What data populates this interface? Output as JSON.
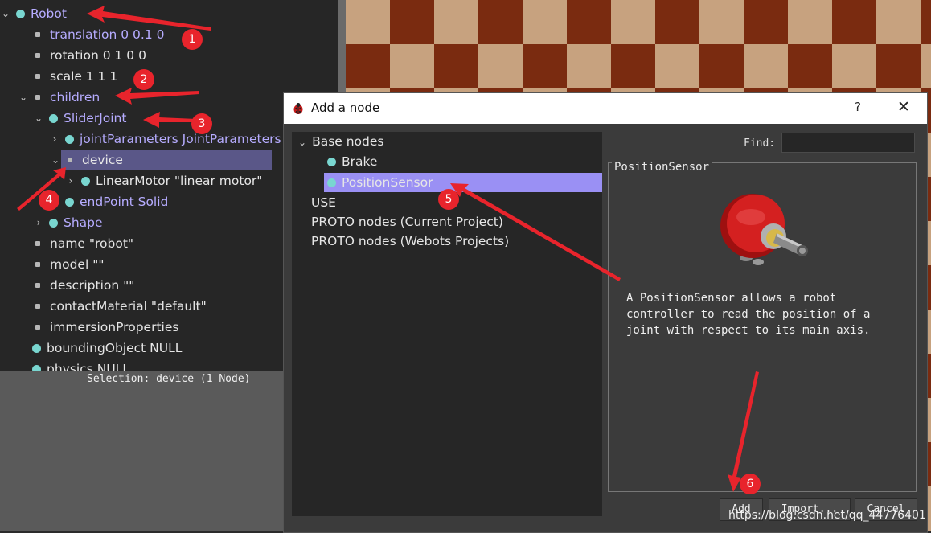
{
  "scene_tree": {
    "nodes": [
      {
        "label": "Robot"
      },
      {
        "label": "translation 0 0.1 0"
      },
      {
        "label": "rotation 0 1 0 0"
      },
      {
        "label": "scale 1 1 1"
      },
      {
        "label": "children"
      },
      {
        "label": "SliderJoint"
      },
      {
        "label": "jointParameters JointParameters"
      },
      {
        "label": "device"
      },
      {
        "label": "LinearMotor \"linear motor\""
      },
      {
        "label": "endPoint Solid"
      },
      {
        "label": "Shape"
      },
      {
        "label": "name \"robot\""
      },
      {
        "label": "model \"\""
      },
      {
        "label": "description \"\""
      },
      {
        "label": "contactMaterial \"default\""
      },
      {
        "label": "immersionProperties"
      },
      {
        "label": "boundingObject NULL"
      },
      {
        "label": "physics NULL"
      }
    ],
    "status": "Selection: device (1 Node)"
  },
  "dialog": {
    "title": "Add a node",
    "help": "?",
    "close": "✕",
    "list": [
      {
        "label": "Base nodes"
      },
      {
        "label": "Brake"
      },
      {
        "label": "PositionSensor"
      },
      {
        "label": "USE"
      },
      {
        "label": "PROTO nodes (Current Project)"
      },
      {
        "label": "PROTO nodes (Webots Projects)"
      }
    ],
    "find_label": "Find:",
    "find_value": "",
    "info_title": "PositionSensor",
    "info_desc": "A PositionSensor allows a robot controller to read the position of a joint with respect to its main axis.",
    "buttons": {
      "add": "Add",
      "import": "Import...",
      "cancel": "Cancel"
    }
  },
  "annotations": [
    "1",
    "2",
    "3",
    "4",
    "5",
    "6"
  ],
  "watermark": "https://blog.csdn.net/qq_44776401",
  "colors": {
    "accent": "#9a90f4",
    "badge": "#e8242c",
    "node_dot": "#79d6d0"
  }
}
